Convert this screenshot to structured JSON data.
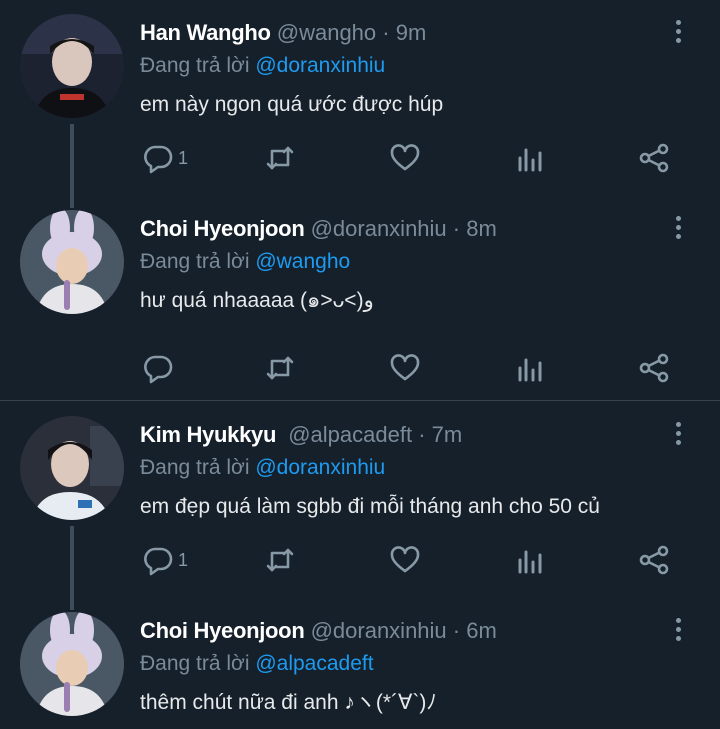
{
  "tweets": [
    {
      "name": "Han Wangho",
      "handle": "@wangho",
      "dot": "·",
      "time": "9m",
      "reply_prefix": "Đang trả lời",
      "reply_to": "@doranxinhiu",
      "text": "em này ngon quá ước được húp",
      "reply_count": "1",
      "avatar_colors": [
        "#1d2230",
        "#c9b8b0"
      ]
    },
    {
      "name": "Choi Hyeonjoon",
      "handle": "@doranxinhiu",
      "dot": "·",
      "time": "8m",
      "reply_prefix": "Đang trả lời",
      "reply_to": "@wangho",
      "text": "hư quá nhaaaaa (๑>ᴗ<)و",
      "reply_count": "",
      "avatar_colors": [
        "#6a7d8c",
        "#d8d0e6"
      ]
    },
    {
      "name": "Kim Hyukkyu",
      "handle": "@alpacadeft",
      "dot": "·",
      "time": "7m",
      "reply_prefix": "Đang trả lời",
      "reply_to": "@doranxinhiu",
      "text": "em đẹp quá làm sgbb đi mỗi tháng anh cho 50 củ",
      "reply_count": "1",
      "avatar_colors": [
        "#2a2f3a",
        "#e6ecf2"
      ]
    },
    {
      "name": "Choi Hyeonjoon",
      "handle": "@doranxinhiu",
      "dot": "·",
      "time": "6m",
      "reply_prefix": "Đang trả lời",
      "reply_to": "@alpacadeft",
      "text": "thêm chút nữa đi anh ♪ヽ(*´∀`)ﾉ",
      "reply_count": "",
      "avatar_colors": [
        "#6a7d8c",
        "#d8d0e6"
      ]
    }
  ],
  "icons": {
    "reply": "reply-icon",
    "retweet": "retweet-icon",
    "like": "heart-icon",
    "analytics": "analytics-icon",
    "share": "share-icon",
    "more": "more-vertical-icon"
  },
  "colors": {
    "background": "#15202b",
    "mention": "#1d9bf0",
    "muted": "#8899a6",
    "divider": "#38444d"
  }
}
